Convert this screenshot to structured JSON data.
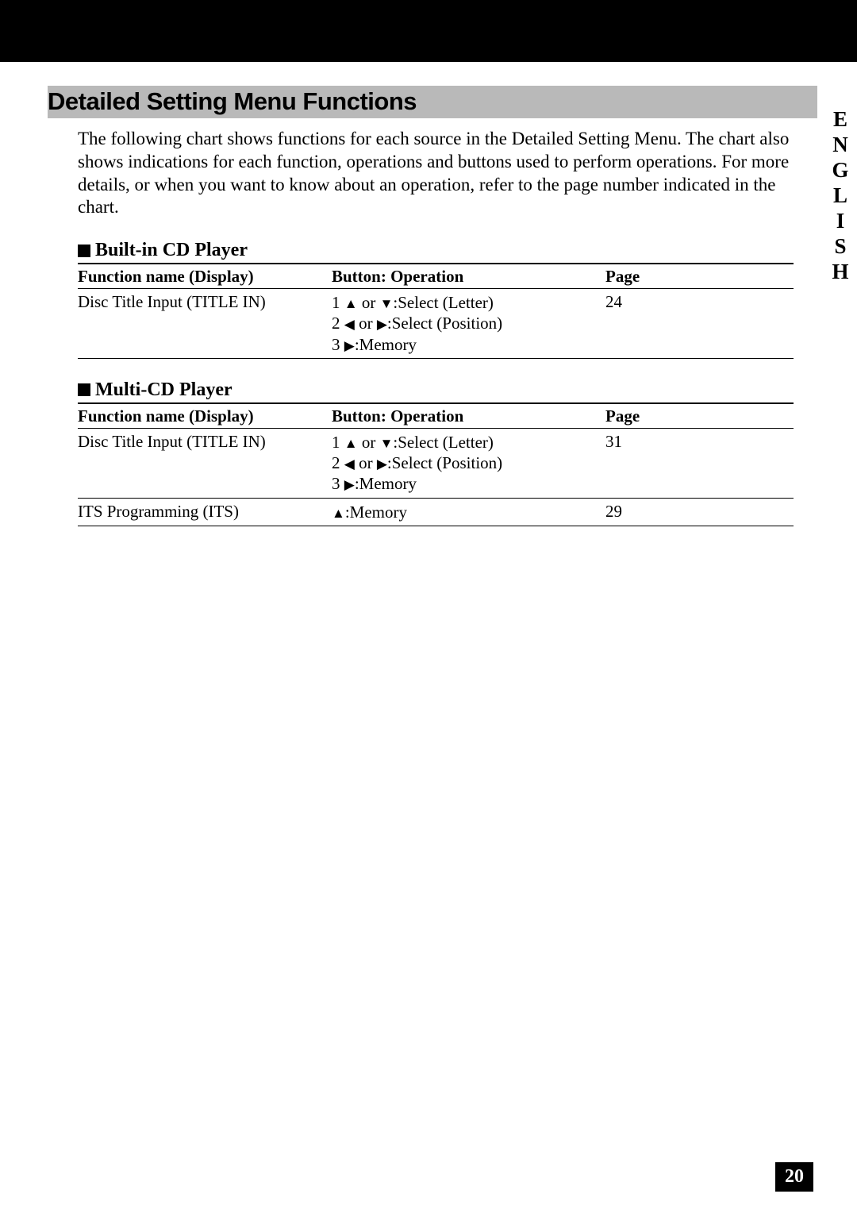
{
  "title": "Detailed Setting Menu Functions",
  "intro": "The following chart shows functions for each source in the Detailed Setting Menu. The chart also shows indications for each function, operations and buttons used to perform operations. For more details, or when you want to know about an operation, refer to the page number indicated in the chart.",
  "side_label": "ENGLISH",
  "page_number": "20",
  "headers": {
    "function": "Function name (Display)",
    "operation": "Button: Operation",
    "page": "Page"
  },
  "glyphs": {
    "up": "▲",
    "down": "▼",
    "left": "◀",
    "right": "▶",
    "or": " or ",
    "select_letter": ":Select (Letter)",
    "select_position": ":Select (Position)",
    "memory": ":Memory",
    "one": "1 ",
    "two": "2 ",
    "three": "3 "
  },
  "sections": [
    {
      "title": "Built-in CD Player",
      "rows": [
        {
          "function": "Disc Title Input (TITLE IN)",
          "page": "24",
          "ops": [
            {
              "parts": [
                "one",
                "up",
                "or",
                "down",
                "select_letter"
              ]
            },
            {
              "parts": [
                "two",
                "left",
                "or",
                "right",
                "select_position"
              ]
            },
            {
              "parts": [
                "three",
                "right",
                "memory"
              ]
            }
          ]
        }
      ]
    },
    {
      "title": "Multi-CD Player",
      "rows": [
        {
          "function": "Disc Title Input (TITLE IN)",
          "page": "31",
          "ops": [
            {
              "parts": [
                "one",
                "up",
                "or",
                "down",
                "select_letter"
              ]
            },
            {
              "parts": [
                "two",
                "left",
                "or",
                "right",
                "select_position"
              ]
            },
            {
              "parts": [
                "three",
                "right",
                "memory"
              ]
            }
          ]
        },
        {
          "function": "ITS Programming (ITS)",
          "page": "29",
          "ops": [
            {
              "parts": [
                "up",
                "memory"
              ]
            }
          ]
        }
      ]
    }
  ]
}
